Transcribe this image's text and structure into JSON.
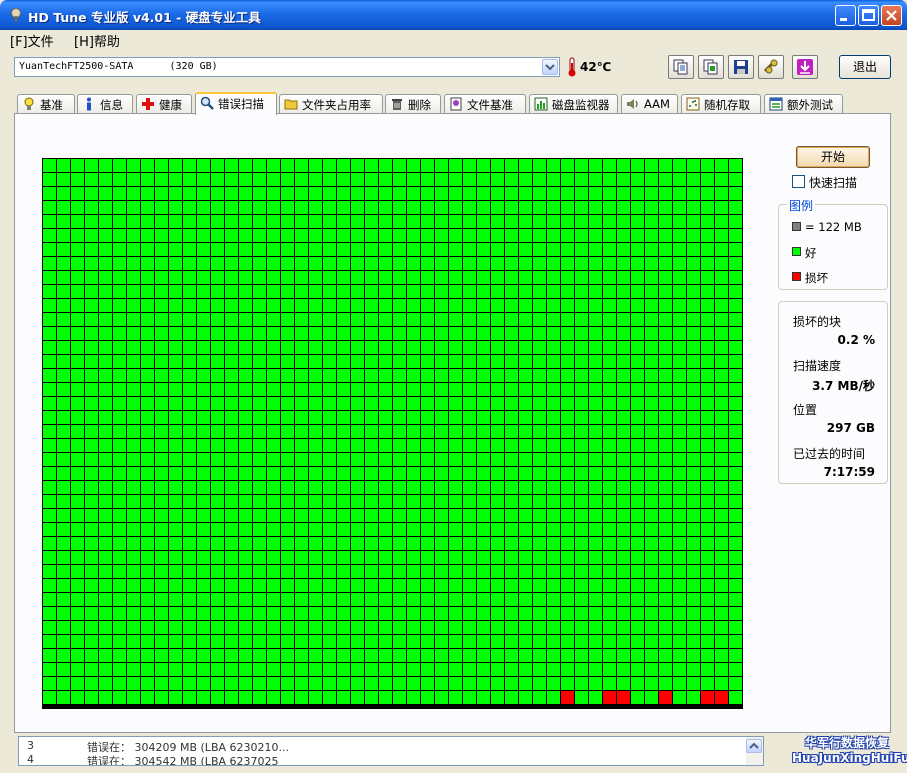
{
  "window": {
    "title": "HD Tune 专业版 v4.01 - 硬盘专业工具"
  },
  "menu": {
    "file": "[F]文件",
    "help": "[H]帮助"
  },
  "toolbar": {
    "drive": "YuanTechFT2500-SATA      (320 GB)",
    "temperature": "42℃",
    "exit_label": "退出",
    "buttons": [
      "copy-text-icon",
      "copy-screenshot-icon",
      "save-icon",
      "options-icon",
      "download-icon"
    ]
  },
  "tabs": [
    {
      "label": "基准",
      "icon": "bulb-icon"
    },
    {
      "label": "信息",
      "icon": "info-icon"
    },
    {
      "label": "健康",
      "icon": "health-cross-icon"
    },
    {
      "label": "错误扫描",
      "icon": "magnifier-icon",
      "active": true
    },
    {
      "label": "文件夹占用率",
      "icon": "folder-icon"
    },
    {
      "label": "删除",
      "icon": "trash-icon"
    },
    {
      "label": "文件基准",
      "icon": "file-benchmark-icon"
    },
    {
      "label": "磁盘监视器",
      "icon": "disk-monitor-icon"
    },
    {
      "label": "AAM",
      "icon": "speaker-icon"
    },
    {
      "label": "随机存取",
      "icon": "random-access-icon"
    },
    {
      "label": "额外测试",
      "icon": "extra-tests-icon"
    }
  ],
  "scan": {
    "start_label": "开始",
    "quick_scan_label": "快速扫描",
    "quick_scan_checked": false,
    "grid_columns": 50,
    "grid_rows": 39,
    "bad_blocks": [
      [
        38,
        37
      ],
      [
        38,
        40
      ],
      [
        38,
        41
      ],
      [
        38,
        44
      ],
      [
        38,
        47
      ],
      [
        38,
        48
      ]
    ]
  },
  "legend": {
    "title": "图例",
    "block_size": "= 122 MB",
    "good": "好",
    "bad": "损坏",
    "colors": {
      "block": "#808080",
      "good": "#00FF00",
      "bad": "#FF0000"
    }
  },
  "stats": {
    "bad_blocks_label": "损坏的块",
    "bad_blocks_value": "0.2 %",
    "speed_label": "扫描速度",
    "speed_value": "3.7 MB/秒",
    "position_label": "位置",
    "position_value": "297 GB",
    "elapsed_label": "已过去的时间",
    "elapsed_value": "7:17:59"
  },
  "log": [
    {
      "num": "3",
      "text": "错误在：  304209 MB (LBA 6230210..."
    },
    {
      "num": "4",
      "text": "错误在：  304542 MB (LBA 6237025"
    }
  ],
  "watermark": {
    "line1": "华军行数据恢复",
    "line2": "HuaJunXingHuiFu"
  }
}
